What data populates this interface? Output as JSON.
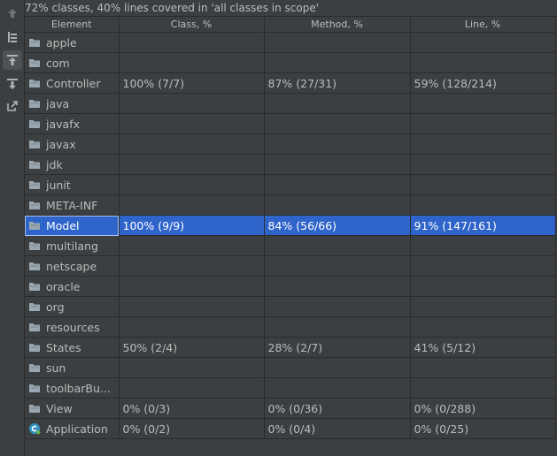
{
  "header": {
    "summary": "72% classes, 40% lines covered in 'all classes in scope'"
  },
  "toolbar": {
    "buttons": [
      {
        "name": "navigate-up-icon"
      },
      {
        "name": "flatten-packages-icon"
      },
      {
        "name": "autoscroll-to-source-icon"
      },
      {
        "name": "autoscroll-from-source-icon"
      },
      {
        "name": "export-report-icon"
      }
    ]
  },
  "table": {
    "columns": [
      "Element",
      "Class, %",
      "Method, %",
      "Line, %"
    ],
    "rows": [
      {
        "name": "apple",
        "icon": "package-folder-icon",
        "class": "",
        "method": "",
        "line": ""
      },
      {
        "name": "com",
        "icon": "package-folder-icon",
        "class": "",
        "method": "",
        "line": ""
      },
      {
        "name": "Controller",
        "icon": "package-folder-icon",
        "class": "100% (7/7)",
        "method": "87% (27/31)",
        "line": "59% (128/214)"
      },
      {
        "name": "java",
        "icon": "package-folder-icon",
        "class": "",
        "method": "",
        "line": ""
      },
      {
        "name": "javafx",
        "icon": "package-folder-icon",
        "class": "",
        "method": "",
        "line": ""
      },
      {
        "name": "javax",
        "icon": "package-folder-icon",
        "class": "",
        "method": "",
        "line": ""
      },
      {
        "name": "jdk",
        "icon": "package-folder-icon",
        "class": "",
        "method": "",
        "line": ""
      },
      {
        "name": "junit",
        "icon": "package-folder-icon",
        "class": "",
        "method": "",
        "line": ""
      },
      {
        "name": "META-INF",
        "icon": "package-folder-icon",
        "class": "",
        "method": "",
        "line": ""
      },
      {
        "name": "Model",
        "icon": "package-folder-icon",
        "class": "100% (9/9)",
        "method": "84% (56/66)",
        "line": "91% (147/161)",
        "selected": true
      },
      {
        "name": "multilang",
        "icon": "package-folder-icon",
        "class": "",
        "method": "",
        "line": ""
      },
      {
        "name": "netscape",
        "icon": "package-folder-icon",
        "class": "",
        "method": "",
        "line": ""
      },
      {
        "name": "oracle",
        "icon": "package-folder-icon",
        "class": "",
        "method": "",
        "line": ""
      },
      {
        "name": "org",
        "icon": "package-folder-icon",
        "class": "",
        "method": "",
        "line": ""
      },
      {
        "name": "resources",
        "icon": "package-folder-icon",
        "class": "",
        "method": "",
        "line": ""
      },
      {
        "name": "States",
        "icon": "package-folder-icon",
        "class": "50% (2/4)",
        "method": "28% (2/7)",
        "line": "41% (5/12)"
      },
      {
        "name": "sun",
        "icon": "package-folder-icon",
        "class": "",
        "method": "",
        "line": ""
      },
      {
        "name": "toolbarBu...",
        "icon": "package-folder-icon",
        "class": "",
        "method": "",
        "line": ""
      },
      {
        "name": "View",
        "icon": "package-folder-icon",
        "class": "0% (0/3)",
        "method": "0% (0/36)",
        "line": "0% (0/288)"
      },
      {
        "name": "Application",
        "icon": "java-class-icon",
        "class": "0% (0/2)",
        "method": "0% (0/4)",
        "line": "0% (0/25)"
      }
    ]
  },
  "colors": {
    "background": "#3c3f41",
    "grid": "#2b2b2b",
    "text": "#bbbbbb",
    "selection": "#2f65ca",
    "folder": "#9aa7b0",
    "class_icon": "#3592c4"
  }
}
